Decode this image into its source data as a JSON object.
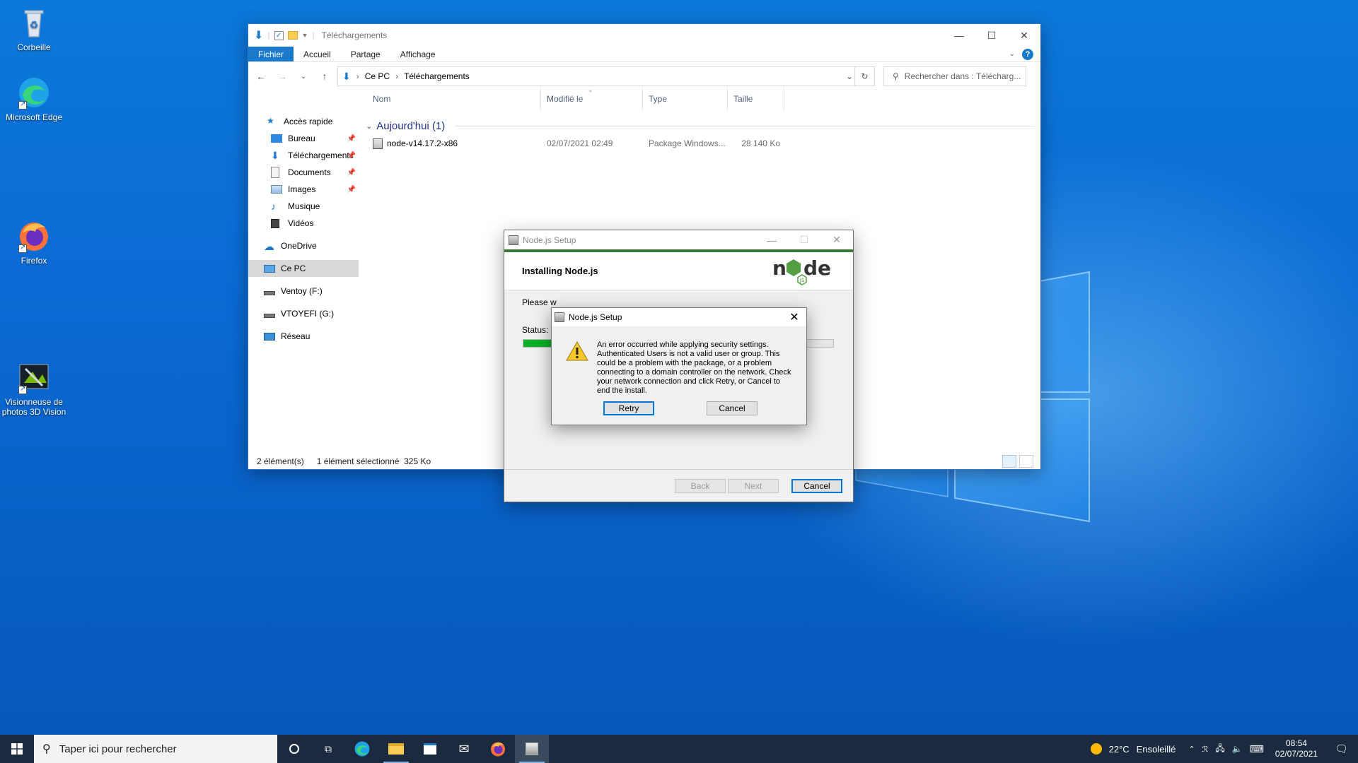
{
  "desktop": {
    "icons": [
      {
        "label": "Corbeille"
      },
      {
        "label": "Microsoft Edge"
      },
      {
        "label": "Firefox"
      },
      {
        "label": "Visionneuse de photos 3D Vision"
      }
    ]
  },
  "explorer": {
    "title": "Téléchargements",
    "ribbon_tabs": [
      "Fichier",
      "Accueil",
      "Partage",
      "Affichage"
    ],
    "breadcrumb": [
      "Ce PC",
      "Téléchargements"
    ],
    "search_placeholder": "Rechercher dans : Télécharg...",
    "nav": {
      "quick_access": "Accès rapide",
      "quick_items": [
        {
          "label": "Bureau"
        },
        {
          "label": "Téléchargements"
        },
        {
          "label": "Documents"
        },
        {
          "label": "Images"
        },
        {
          "label": "Musique"
        },
        {
          "label": "Vidéos"
        }
      ],
      "onedrive": "OneDrive",
      "this_pc": "Ce PC",
      "drive_f": "Ventoy (F:)",
      "drive_g": "VTOYEFI (G:)",
      "network": "Réseau"
    },
    "columns": {
      "name": "Nom",
      "modified": "Modifié le",
      "type": "Type",
      "size": "Taille"
    },
    "group": "Aujourd'hui (1)",
    "files": [
      {
        "name": "node-v14.17.2-x86",
        "modified": "02/07/2021 02:49",
        "type": "Package Windows...",
        "size": "28 140 Ko"
      }
    ],
    "status": {
      "count": "2 élément(s)",
      "selected": "1 élément sélectionné  325 Ko"
    }
  },
  "setup": {
    "title": "Node.js Setup",
    "heading": "Installing Node.js",
    "please_wait": "Please w",
    "status_label": "Status:",
    "progress_fraction": 0.18,
    "buttons": {
      "back": "Back",
      "next": "Next",
      "cancel": "Cancel"
    }
  },
  "error_dialog": {
    "title": "Node.js Setup",
    "message": "An error occurred while applying security settings. Authenticated Users is not a valid user or group. This could be a problem with the package, or a problem connecting to a domain controller on the network. Check your network connection and click Retry, or Cancel to end the install.",
    "retry": "Retry",
    "cancel": "Cancel"
  },
  "taskbar": {
    "search_placeholder": "Taper ici pour rechercher",
    "weather_temp": "22°C",
    "weather_desc": "Ensoleillé",
    "time": "08:54",
    "date": "02/07/2021"
  },
  "colors": {
    "accent": "#1979ca",
    "node_green": "#3d7a35",
    "taskbar": "#1b2a3e"
  }
}
